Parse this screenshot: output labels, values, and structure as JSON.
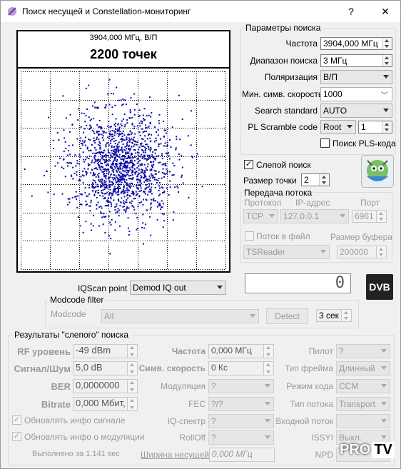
{
  "window": {
    "title": "Поиск несущей и Constellation-мониторинг",
    "help": "?",
    "close": "✕"
  },
  "plot": {
    "subtitle": "3904,000 МГц, В/П",
    "title": "2200 точек",
    "points_count": 2200
  },
  "params": {
    "group_title": "Параметры поиска",
    "freq_label": "Частота",
    "freq_value": "3904,000 МГц",
    "range_label": "Диапазон поиска",
    "range_value": "3 МГц",
    "pol_label": "Поляризация",
    "pol_value": "В/П",
    "minsr_label": "Мин. симв. скорость",
    "minsr_value": "1000",
    "std_label": "Search standard",
    "std_value": "AUTO",
    "pls_label": "PL Scramble code",
    "pls_mode": "Root",
    "pls_value": "1",
    "pls_search_label": "Поиск PLS-кода"
  },
  "blind": {
    "label": "Слепой поиск",
    "checked": "✓",
    "dotsize_label": "Размер точки",
    "dotsize_value": "2"
  },
  "stream": {
    "group_title": "Передача потока",
    "proto_label": "Протокол",
    "ip_label": "IP-адрес",
    "port_label": "Порт",
    "proto_value": "TCP",
    "ip_value": "127.0.0.1",
    "port_value": "6961",
    "tofile_label": "Поток в файл",
    "buffer_label": "Размер буфера",
    "reader_value": "TSReader",
    "buffer_value": "200000"
  },
  "counter": {
    "value": "0"
  },
  "dvb_logo": "DVB",
  "iqscan": {
    "label": "IQScan point",
    "value": "Demod IQ out"
  },
  "modcode": {
    "group_title": "Modcode filter",
    "label": "Modcode",
    "value": "All",
    "detect": "Detect",
    "timeout": "3 сек"
  },
  "results": {
    "group_title": "Результаты \"слепого\" поиска",
    "rf_label": "RF уровень",
    "rf_value": "-49 dBm",
    "snr_label": "Сигнал/Шум",
    "snr_value": "5,0 dB",
    "ber_label": "BER",
    "ber_value": "0,0000000",
    "bitrate_label": "Bitrate",
    "bitrate_value": "0,000 Мбит,",
    "freq_label": "Частота",
    "freq_value": "0,000 МГц",
    "sr_label": "Симв. скорость",
    "sr_value": "0 Кс",
    "mod_label": "Модуляция",
    "mod_value": "?",
    "fec_label": "FEC",
    "fec_value": "?/?",
    "iq_label": "IQ-спектр",
    "iq_value": "?",
    "rolloff_label": "RollOff",
    "rolloff_value": "?",
    "pilot_label": "Пилот",
    "pilot_value": "?",
    "frame_label": "Тип фрейма",
    "frame_value": "Длинный",
    "codemode_label": "Режим кода",
    "codemode_value": "CCM",
    "streamtype_label": "Тип потока",
    "streamtype_value": "Transport",
    "input_label": "Входной поток",
    "input_value": "",
    "issyi_label": "ISSYI",
    "issyi_value": "Выкл.",
    "npd_label": "NPD",
    "npd_value": "",
    "upd_signal_label": "Обновлять инфо сигнале",
    "upd_mod_label": "Обновлять инфо о модуляции",
    "done_label": "Выполнено за 1.141 sec",
    "bandwidth_label": "Ширина несущей",
    "bandwidth_value": "0,000 МГц"
  },
  "watermark": {
    "text": "PRO",
    "tv": "TV"
  },
  "colors": {
    "dots": "#0a0aa8",
    "grid": "#000000"
  }
}
